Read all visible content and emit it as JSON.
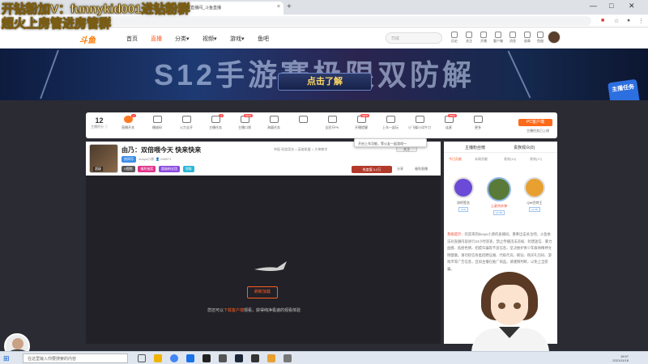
{
  "browser": {
    "tab_title": "...的直播间_斗鱼直播",
    "new_tab": "+",
    "win_controls": [
      "—",
      "□",
      "✕"
    ]
  },
  "site": {
    "logo": "斗鱼",
    "nav": [
      "首页",
      "直播",
      "分类▾",
      "视频▾",
      "游戏▾",
      "鱼吧"
    ],
    "search_placeholder": "司威",
    "header_icons": [
      "历史",
      "关注",
      "开播",
      "客户端",
      "消息",
      "勋章",
      "鱼翅"
    ]
  },
  "banner": {
    "headline": "S12手游赛极限双防解",
    "cta": "点击了解",
    "badge": "主播任务"
  },
  "toolbar": {
    "level_num": "12",
    "level_label": "主播积分 ⓘ",
    "tools": [
      {
        "label": "直播开关",
        "badge": "1"
      },
      {
        "label": "播放码",
        "badge": ""
      },
      {
        "label": "火力全开",
        "badge": ""
      },
      {
        "label": "主播任务",
        "badge": "3"
      },
      {
        "label": "主播口袋",
        "badge": "NEW"
      },
      {
        "label": "海量任务",
        "badge": ""
      },
      {
        "label": "",
        "badge": ""
      },
      {
        "label": "全民开PK",
        "badge": ""
      },
      {
        "label": "开播提醒",
        "badge": "NEW"
      },
      {
        "label": "上车一起玩",
        "badge": ""
      },
      {
        "label": "小飞碟小试牛刀",
        "badge": ""
      },
      {
        "label": "连麦",
        "badge": "NEW"
      },
      {
        "label": "更多",
        "badge": ""
      }
    ],
    "pc_button": "PC客户端",
    "pc_sub": "主播任务已上线",
    "tooltip": "开启上车功能，等火友一起游戏～"
  },
  "streamer": {
    "title": "由乃：双倍喂今天 快来快来",
    "meta": "举报  网游竞技 > 英雄联盟 > 大神教学",
    "room_tag": "房间号",
    "room_id": "douyu小源",
    "followers": "640571",
    "chips": [
      "V视频",
      "福利抽奖",
      "超级粉丝团",
      "领取"
    ],
    "report_btn": "热度值 0.2万",
    "share": "分享",
    "collect": "福利直播",
    "follow": "关注",
    "avatar_mark": "超级"
  },
  "player": {
    "refresh_btn": "刷新加载",
    "tip_prefix": "您还可以",
    "tip_link": "下载客户端",
    "tip_suffix": "观看，获得纯净极速的观看体验"
  },
  "right_panel": {
    "top_tabs": [
      "主播粉丝榜",
      "贵族观众(0)"
    ],
    "tabs": [
      "今日贡献",
      "本周贡献",
      "贵宾(12)",
      "贵宾(17)"
    ],
    "ranks": [
      {
        "name": "凉柯签名",
        "lv": "LV 8",
        "color": "#6a4ad6"
      },
      {
        "name": "土豪杰炸弹",
        "lv": "LV 45",
        "color": "#5a7a3a"
      },
      {
        "name": "QW巴特王",
        "lv": "LV 36",
        "color": "#e8a030"
      }
    ],
    "chat_sys": "系统提示：",
    "chat_text": "欢迎来到douyu小源的直播间。重拳出击关注吧。斗鱼依法对直播内容进行24小时巡查，禁止传播违法违规、封建迷信、暴力血腥、低俗色情、招嫖诈骗等不良信息，坚决维护青少年群体精神文明健康。请勿轻信各类招聘征婚、代练代充、刷钻、购买礼包码、游戏币等广告信息，且如主播在推广商品，请谨慎判断，以免上当受骗。"
  },
  "taskbar": {
    "start": "⊞",
    "search_placeholder": "在这里输入你要搜索的内容",
    "clock_time": "16:57",
    "clock_date": "2021/11/18"
  },
  "overlay": {
    "line1": "开钻粉加V：funnykid001进钻粉群",
    "line2": "超火上房管进房管群"
  },
  "colors": {
    "accent": "#ff5d23",
    "brand": "#ff7700",
    "dark_bg": "#2b2b33"
  }
}
